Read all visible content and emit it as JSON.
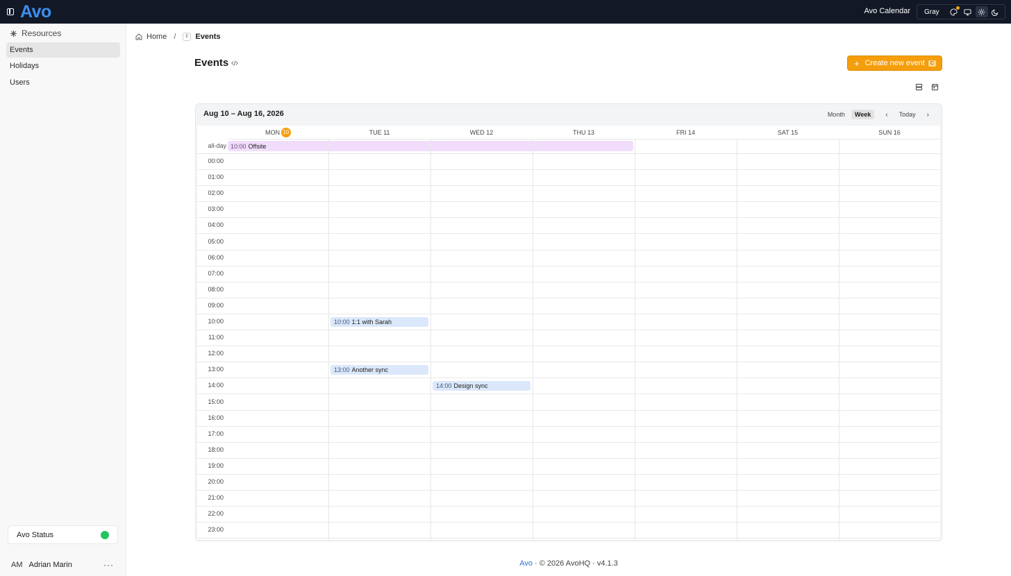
{
  "topbar": {
    "logo": "Avo",
    "app_name": "Avo Calendar",
    "theme_label": "Gray",
    "icons": [
      "sidebar-toggle-icon",
      "palette-icon",
      "monitor-icon",
      "sun-icon",
      "moon-icon"
    ],
    "accent_color": "#f5a623"
  },
  "sidebar": {
    "section_title": "Resources",
    "items": [
      {
        "label": "Events",
        "active": true
      },
      {
        "label": "Holidays",
        "active": false
      },
      {
        "label": "Users",
        "active": false
      }
    ],
    "status_label": "Avo Status",
    "status_color": "#22c55e",
    "user_initials": "AM",
    "user_name": "Adrian Marin",
    "more_label": "···"
  },
  "breadcrumb": {
    "home": "Home",
    "separator": "/",
    "badge": "E",
    "current": "Events"
  },
  "header": {
    "title": "Events",
    "create_label": "Create new event",
    "create_plus": "+",
    "create_shortcut": "C",
    "create_color": "#f59e0b"
  },
  "calendar": {
    "range": "Aug 10 – Aug 16, 2026",
    "views": [
      {
        "label": "Month",
        "active": false
      },
      {
        "label": "Week",
        "active": true
      }
    ],
    "prev": "‹",
    "today": "Today",
    "next": "›",
    "days": [
      {
        "label": "MON",
        "date": "10",
        "today": true
      },
      {
        "label": "TUE 11",
        "today": false
      },
      {
        "label": "WED 12",
        "today": false
      },
      {
        "label": "THU 13",
        "today": false
      },
      {
        "label": "FRI 14",
        "today": false
      },
      {
        "label": "SAT 15",
        "today": false
      },
      {
        "label": "SUN 16",
        "today": false
      }
    ],
    "allday_label": "all-day",
    "allday_event": {
      "time": "10:00",
      "title": "Offsite",
      "start_day": 0,
      "span_days": 4
    },
    "hours": [
      "00:00",
      "01:00",
      "02:00",
      "03:00",
      "04:00",
      "05:00",
      "06:00",
      "07:00",
      "08:00",
      "09:00",
      "10:00",
      "11:00",
      "12:00",
      "13:00",
      "14:00",
      "15:00",
      "16:00",
      "17:00",
      "18:00",
      "19:00",
      "20:00",
      "21:00",
      "22:00",
      "23:00"
    ],
    "events": [
      {
        "time": "10:00",
        "title": "1:1 with Sarah",
        "day": 1,
        "hour": 10
      },
      {
        "time": "13:00",
        "title": "Another sync",
        "day": 1,
        "hour": 13
      },
      {
        "time": "14:00",
        "title": "Design sync",
        "day": 2,
        "hour": 14
      }
    ]
  },
  "footer": {
    "brand": "Avo",
    "text": " · © 2026 AvoHQ · v4.1.3"
  }
}
